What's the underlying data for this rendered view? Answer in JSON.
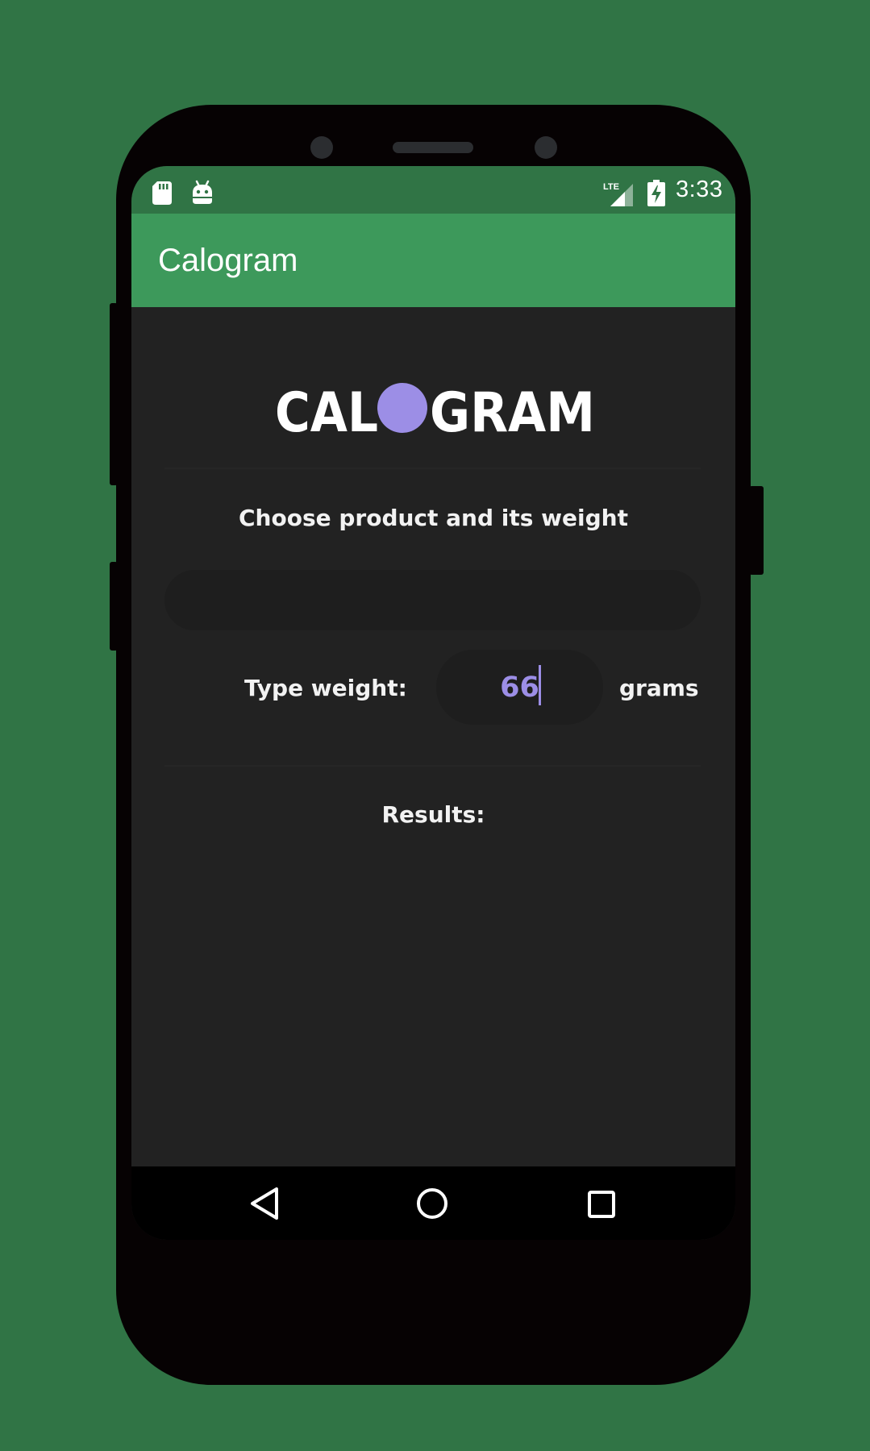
{
  "status_bar": {
    "time": "3:33",
    "network_label": "LTE"
  },
  "app_bar": {
    "title": "Calogram"
  },
  "logo": {
    "text_left": "CAL",
    "text_right": "GRAM",
    "dot_color": "#9c8ee6"
  },
  "main": {
    "instruction": "Choose product and its weight",
    "product_field_value": "",
    "weight_label": "Type weight:",
    "weight_value": "66",
    "weight_unit": "grams",
    "results_label": "Results:"
  },
  "colors": {
    "background": "#307445",
    "status_bar": "#307445",
    "app_bar": "#3d995b",
    "content_bg": "#222222",
    "accent": "#9c8ee6"
  },
  "icons": {
    "status_left": [
      "sd-card-icon",
      "android-debug-icon"
    ],
    "status_right": [
      "lte-signal-icon",
      "battery-charging-icon"
    ],
    "nav": [
      "back-icon",
      "home-icon",
      "recent-apps-icon"
    ]
  }
}
